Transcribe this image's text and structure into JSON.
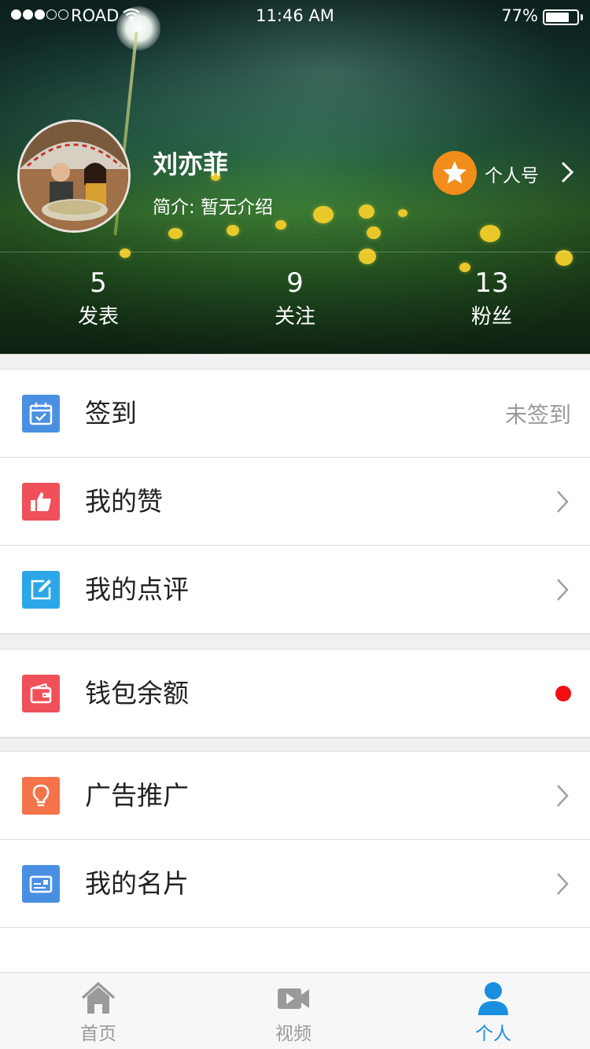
{
  "status_bar": {
    "carrier": "ROAD",
    "time": "11:46 AM",
    "battery": "77%",
    "battery_level": 0.77,
    "signal_strength": 3,
    "signal_max": 5
  },
  "profile": {
    "name": "刘亦菲",
    "bio": "简介: 暂无介绍",
    "account_label": "个人号",
    "stats": [
      {
        "value": "5",
        "label": "发表"
      },
      {
        "value": "9",
        "label": "关注"
      },
      {
        "value": "13",
        "label": "粉丝"
      }
    ]
  },
  "menu": {
    "checkin": {
      "label": "签到",
      "status": "未签到",
      "icon": "calendar-check-icon",
      "color": "#4a90e2"
    },
    "likes": {
      "label": "我的赞",
      "icon": "thumbs-up-icon",
      "color": "#f0505a"
    },
    "reviews": {
      "label": "我的点评",
      "icon": "edit-icon",
      "color": "#2ba7e8"
    },
    "wallet": {
      "label": "钱包余额",
      "icon": "wallet-icon",
      "color": "#f0505a",
      "badge_color": "#f01010"
    },
    "ads": {
      "label": "广告推广",
      "icon": "lightbulb-icon",
      "color": "#f4734a"
    },
    "card": {
      "label": "我的名片",
      "icon": "card-icon",
      "color": "#4a90e2"
    }
  },
  "tabbar": {
    "tabs": [
      {
        "label": "首页",
        "icon": "home-icon"
      },
      {
        "label": "视频",
        "icon": "video-icon"
      },
      {
        "label": "个人",
        "icon": "person-icon",
        "active": true
      }
    ],
    "active_color": "#1a8fe0"
  }
}
